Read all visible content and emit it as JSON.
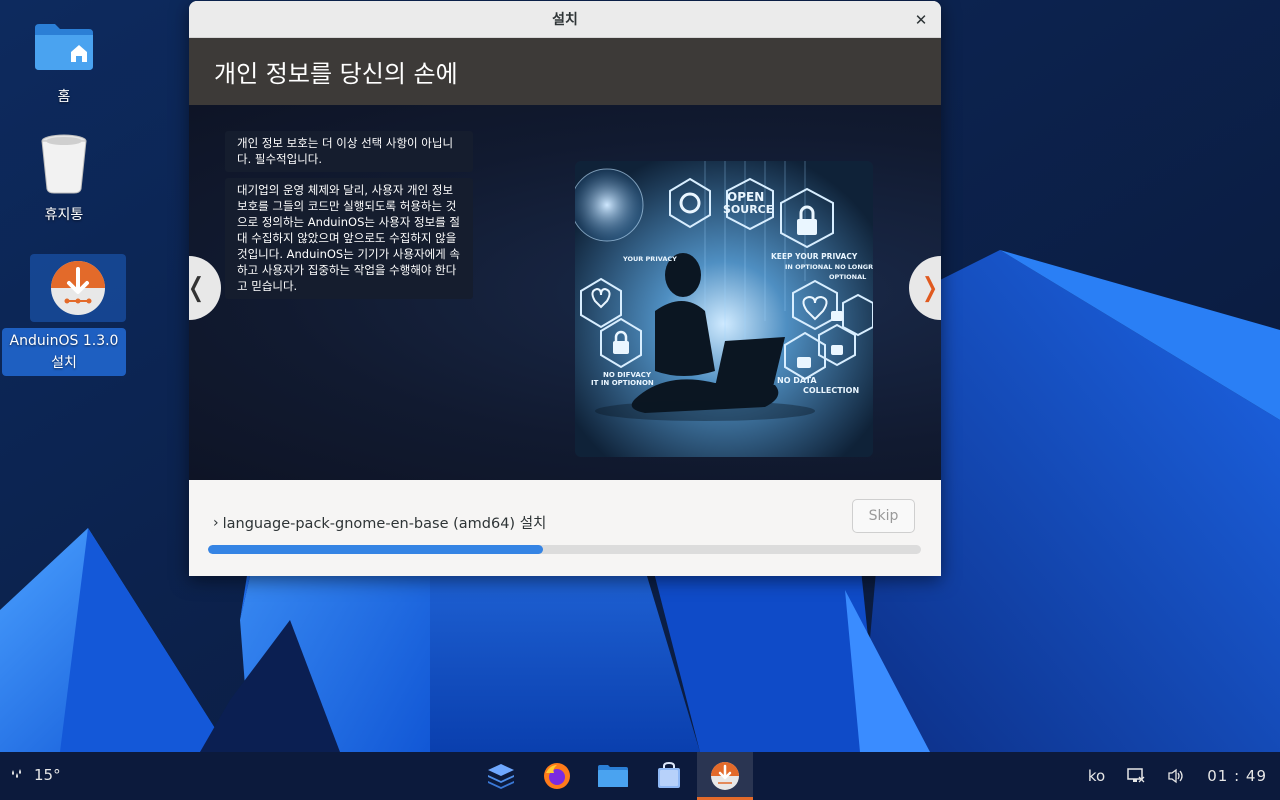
{
  "desktop": {
    "icons": [
      {
        "label": "홈"
      },
      {
        "label": "휴지통"
      },
      {
        "label_line1": "AnduinOS 1.3.0",
        "label_line2": "설치"
      }
    ]
  },
  "window": {
    "title": "설치",
    "close_glyph": "✕",
    "header": "개인 정보를 당신의 손에",
    "slide": {
      "paragraph1": "개인 정보 보호는 더 이상 선택 사항이 아닙니다. 필수적입니다.",
      "paragraph2": "대기업의 운영 체제와 달리, 사용자 개인 정보 보호를 그들의 코드만 실행되도록 허용하는 것으로 정의하는 AnduinOS는 사용자 정보를 절대 수집하지 않았으며 앞으로도 수집하지 않을 것입니다. AnduinOS는 기기가 사용자에게 속하고 사용자가 집중하는 작업을 수행해야 한다고 믿습니다.",
      "image_texts": {
        "open": "OPEN",
        "source": "SOURCE",
        "keep1": "KEEP YOUR PRIVACY",
        "keep2": "IN OPTIONAL NO LONGR",
        "keep3": "OPTIONAL",
        "your_privacy": "YOUR PRIVACY",
        "no_privacy1": "NO DIFVACY",
        "no_privacy2": "IT IN OPTIONON",
        "no_data1": "NO DATA",
        "no_data2": "COLLECTION"
      },
      "prev_glyph": "❬",
      "next_glyph": "❭"
    },
    "progress": {
      "status": "language-pack-gnome-en-base (amd64) 설치",
      "chevron": "›",
      "skip_label": "Skip",
      "fraction": 0.47
    }
  },
  "taskbar": {
    "weather_temp": "15°",
    "weather_glyph": "💧",
    "language": "ko",
    "clock": "01 : 49"
  },
  "colors": {
    "accent": "#3584e4",
    "header_bg": "#3d3a38",
    "brand_orange": "#e36a2a"
  }
}
